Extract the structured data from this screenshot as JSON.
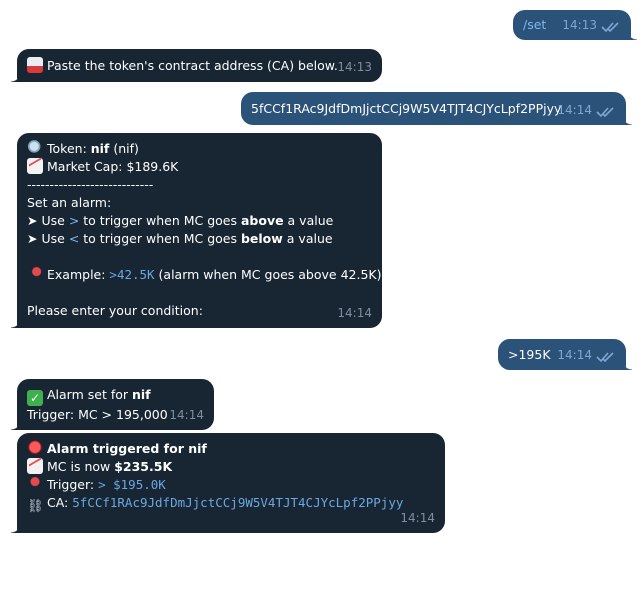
{
  "messages": {
    "m1": {
      "text": "/set",
      "time": "14:13"
    },
    "m2": {
      "text": "Paste the token's contract address (CA) below.",
      "time": "14:13"
    },
    "m3": {
      "text": "5fCCf1RAc9JdfDmJjctCCj9W5V4TJT4CJYcLpf2PPjyy",
      "time": "14:14"
    },
    "m4": {
      "token_label": "Token: ",
      "token_name": "nif",
      "token_ticker": " (nif)",
      "mcap": "Market Cap: $189.6K",
      "divider": "----------------------------",
      "set_alarm": "Set an alarm:",
      "bullet": "➤",
      "use1_pre": "Use ",
      "use1_sym": ">",
      "use1_mid": " to trigger when MC goes ",
      "use1_bold": "above",
      "use1_post": " a value",
      "use2_pre": "Use ",
      "use2_sym": "<",
      "use2_mid": " to trigger when MC goes ",
      "use2_bold": "below",
      "use2_post": " a value",
      "example_label": "Example: ",
      "example_code": ">42.5K",
      "example_post": " (alarm when MC goes above 42.5K)",
      "prompt": "Please enter your condition:",
      "time": "14:14"
    },
    "m5": {
      "text": ">195K",
      "time": "14:14"
    },
    "m6": {
      "line1_pre": "Alarm set for ",
      "line1_bold": "nif",
      "line2": "Trigger: MC > 195,000",
      "time": "14:14"
    },
    "m7": {
      "title": "Alarm triggered for nif",
      "mc_pre": "MC is now ",
      "mc_bold": "$235.5K",
      "trigger_label": "Trigger: ",
      "trigger_code": "> $195.0K",
      "ca_label": "CA: ",
      "ca_code": "5fCCf1RAc9JdfDmJjctCCj9W5V4TJT4CJYcLpf2PPjyy",
      "time": "14:14"
    }
  },
  "icons": {
    "read_ticks": "double-check-icon",
    "inbox": "inbox-tray-icon",
    "search": "magnifier-icon",
    "chart": "chart-increasing-icon",
    "pin": "pushpin-icon",
    "check": "check-mark-button-icon",
    "siren": "police-light-icon",
    "round_pin": "round-pushpin-icon",
    "link": "link-icon"
  },
  "colors": {
    "incoming": "#182533",
    "outgoing": "#2b5278",
    "link": "#6aa8e0",
    "time_in": "#7d8e9f",
    "time_out": "#7da8d3"
  }
}
